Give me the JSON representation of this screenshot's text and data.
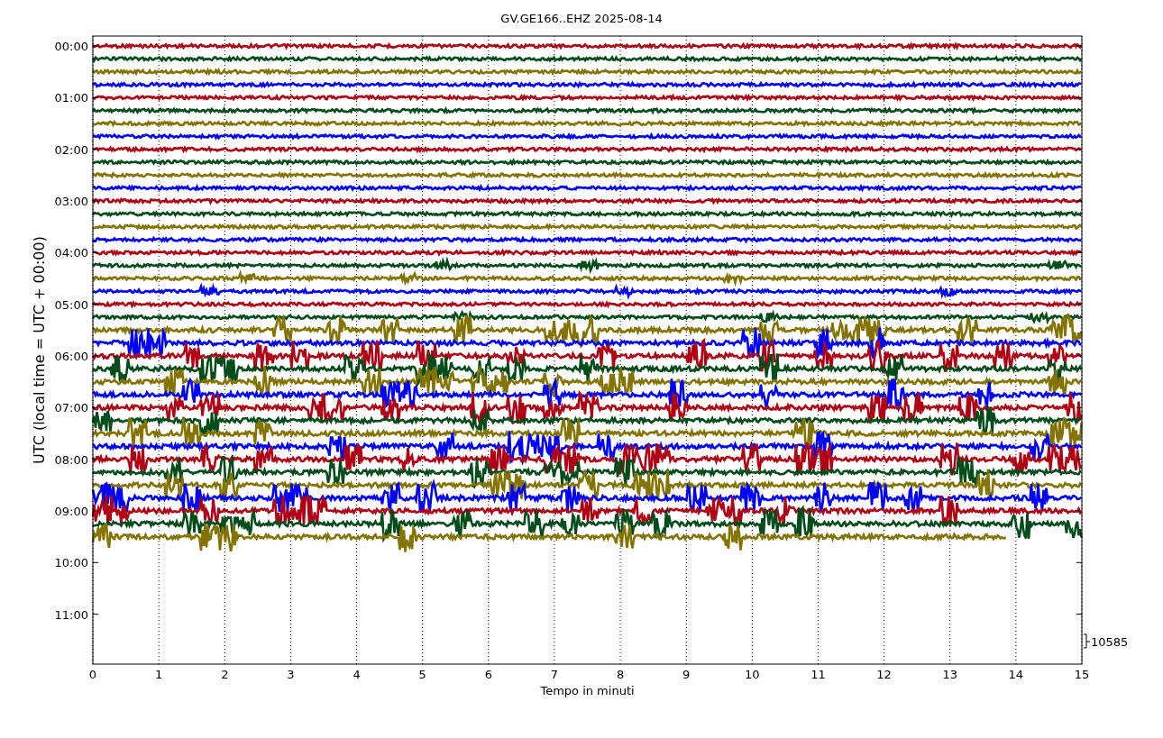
{
  "chart": {
    "title": "GV.GE166..EHZ 2025-08-14",
    "ylabel": "UTC (local time = UTC + 00:00)",
    "xlabel": "Tempo in minuti",
    "yticks": [
      "00:00",
      "01:00",
      "02:00",
      "03:00",
      "04:00",
      "05:00",
      "06:00",
      "07:00",
      "08:00",
      "09:00",
      "10:00",
      "11:00"
    ],
    "xticks": [
      "0",
      "1",
      "2",
      "3",
      "4",
      "5",
      "6",
      "7",
      "8",
      "9",
      "10",
      "11",
      "12",
      "13",
      "14",
      "15"
    ],
    "scale_label": "10585",
    "traces": [
      {
        "color": "#b00014",
        "level": 1
      },
      {
        "color": "#004d1a",
        "level": 1
      },
      {
        "color": "#857300",
        "level": 1
      },
      {
        "color": "#0000ff",
        "level": 1
      },
      {
        "color": "#b00014",
        "level": 1
      },
      {
        "color": "#004d1a",
        "level": 1
      },
      {
        "color": "#857300",
        "level": 1
      },
      {
        "color": "#0000ff",
        "level": 1
      },
      {
        "color": "#b00014",
        "level": 1
      },
      {
        "color": "#004d1a",
        "level": 1
      },
      {
        "color": "#857300",
        "level": 1
      },
      {
        "color": "#0000ff",
        "level": 1
      },
      {
        "color": "#b00014",
        "level": 1
      },
      {
        "color": "#004d1a",
        "level": 1
      },
      {
        "color": "#857300",
        "level": 1
      },
      {
        "color": "#0000ff",
        "level": 1
      },
      {
        "color": "#b00014",
        "level": 1
      },
      {
        "color": "#004d1a",
        "level": 1
      },
      {
        "color": "#857300",
        "level": 1
      },
      {
        "color": "#0000ff",
        "level": 1
      },
      {
        "color": "#b00014",
        "level": 1
      },
      {
        "color": "#004d1a",
        "level": 1
      },
      {
        "color": "#857300",
        "level": 1
      },
      {
        "color": "#0000ff",
        "level": 1
      },
      {
        "color": "#b00014",
        "level": 1
      },
      {
        "color": "#004d1a",
        "level": 1
      },
      {
        "color": "#857300",
        "level": 1
      },
      {
        "color": "#0000ff",
        "level": 1
      },
      {
        "color": "#b00014",
        "level": 1
      },
      {
        "color": "#004d1a",
        "level": 1
      },
      {
        "color": "#857300",
        "level": 1
      },
      {
        "color": "#0000ff",
        "level": 1
      },
      {
        "color": "#b00014",
        "level": 1
      },
      {
        "color": "#004d1a",
        "level": 1
      },
      {
        "color": "#857300",
        "level": 1
      },
      {
        "color": "#0000ff",
        "level": 1
      },
      {
        "color": "#b00014",
        "level": 1
      },
      {
        "color": "#004d1a",
        "level": 1
      },
      {
        "color": "#857300",
        "level": 0.923
      }
    ]
  }
}
